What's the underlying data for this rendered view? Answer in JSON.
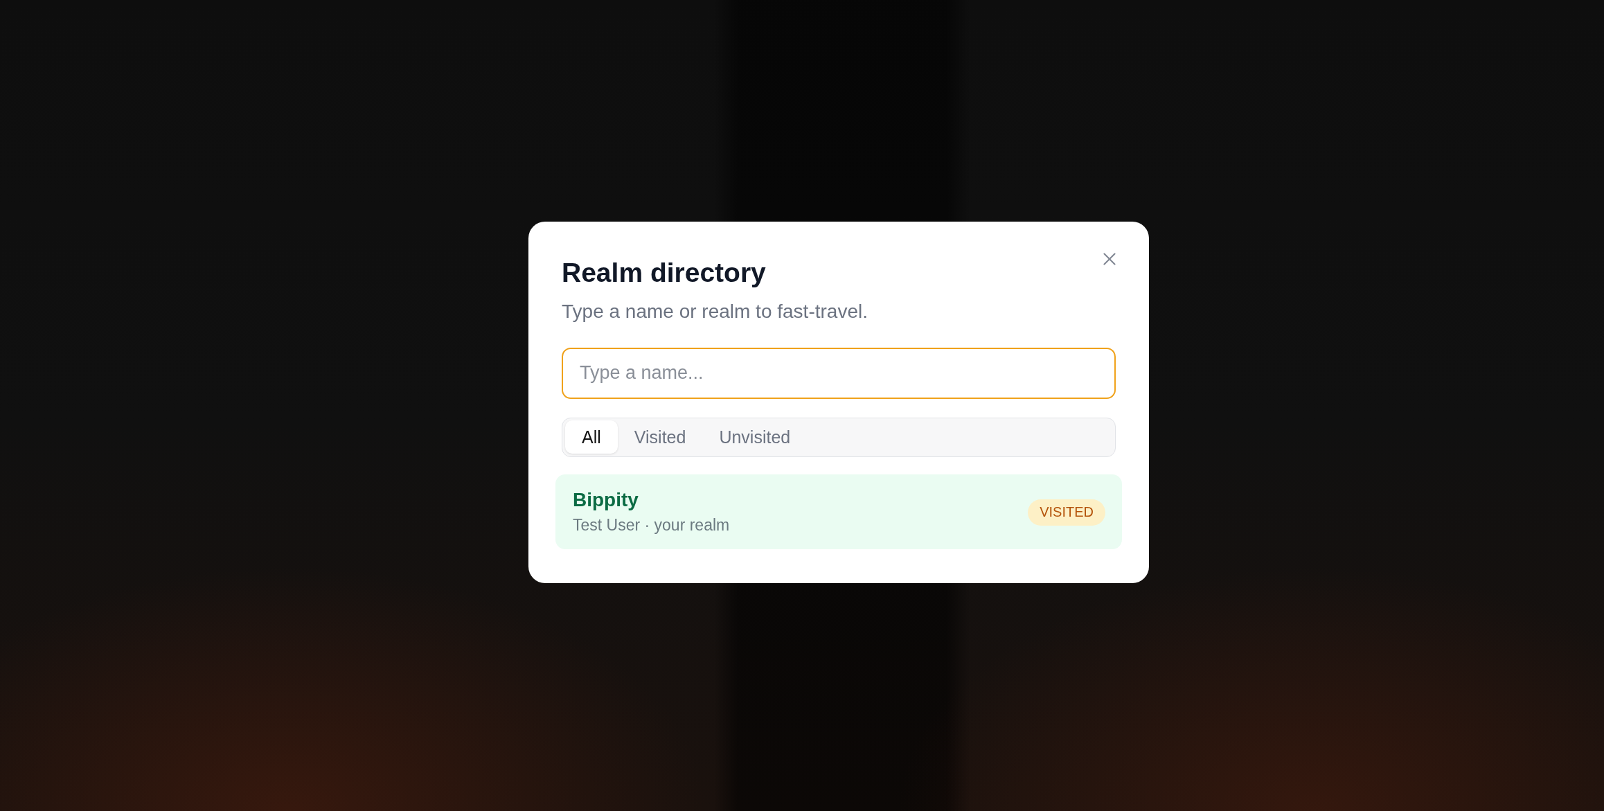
{
  "dialog": {
    "title": "Realm directory",
    "subtitle": "Type a name or realm to fast-travel.",
    "search": {
      "placeholder": "Type a name...",
      "focused": true
    },
    "filters": [
      {
        "label": "All",
        "selected": true
      },
      {
        "label": "Visited",
        "selected": false
      },
      {
        "label": "Unvisited",
        "selected": false
      }
    ],
    "realms": [
      {
        "name": "Bippity",
        "detail": "Test User · your realm",
        "badge": "VISITED",
        "selected": true
      }
    ]
  }
}
